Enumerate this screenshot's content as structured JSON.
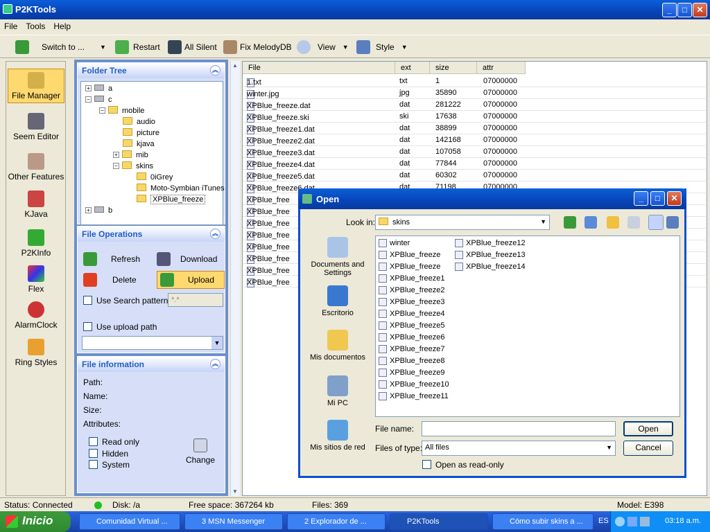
{
  "app": {
    "title": "P2KTools"
  },
  "menu": [
    "File",
    "Tools",
    "Help"
  ],
  "toolbar": {
    "switch_to": "Switch to ...",
    "restart": "Restart",
    "all_silent": "All Silent",
    "fix_melody": "Fix MelodyDB",
    "view": "View",
    "style": "Style"
  },
  "leftbar": [
    {
      "label": "File Manager",
      "icon": "file-manager-icon"
    },
    {
      "label": "Seem Editor",
      "icon": "seem-editor-icon"
    },
    {
      "label": "Other Features",
      "icon": "other-features-icon"
    },
    {
      "label": "KJava",
      "icon": "kjava-icon"
    },
    {
      "label": "P2KInfo",
      "icon": "p2kinfo-icon"
    },
    {
      "label": "Flex",
      "icon": "flex-icon"
    },
    {
      "label": "AlarmClock",
      "icon": "alarm-clock-icon"
    },
    {
      "label": "Ring Styles",
      "icon": "ring-styles-icon"
    }
  ],
  "folder_tree": {
    "title": "Folder Tree",
    "nodes": [
      "a",
      "c",
      "mobile",
      "audio",
      "picture",
      "kjava",
      "mib",
      "skins",
      "0iGrey",
      "Moto-Symbian iTunes",
      "XPBlue_freeze",
      "b"
    ]
  },
  "file_ops": {
    "title": "File Operations",
    "refresh": "Refresh",
    "download": "Download",
    "delete": "Delete",
    "upload": "Upload",
    "use_search": "Use Search pattern:",
    "search_value": "*.*",
    "use_upload_path": "Use upload path"
  },
  "file_info": {
    "title": "File information",
    "path": "Path:",
    "name": "Name:",
    "size": "Size:",
    "attributes": "Attributes:",
    "read_only": "Read only",
    "hidden": "Hidden",
    "system": "System",
    "change": "Change"
  },
  "file_list": {
    "columns": [
      "File",
      "ext",
      "size",
      "attr"
    ],
    "rows": [
      {
        "file": "1.txt",
        "ext": "txt",
        "size": "1",
        "attr": "07000000"
      },
      {
        "file": "winter.jpg",
        "ext": "jpg",
        "size": "35890",
        "attr": "07000000"
      },
      {
        "file": "XPBlue_freeze.dat",
        "ext": "dat",
        "size": "281222",
        "attr": "07000000"
      },
      {
        "file": "XPBlue_freeze.ski",
        "ext": "ski",
        "size": "17638",
        "attr": "07000000"
      },
      {
        "file": "XPBlue_freeze1.dat",
        "ext": "dat",
        "size": "38899",
        "attr": "07000000"
      },
      {
        "file": "XPBlue_freeze2.dat",
        "ext": "dat",
        "size": "142168",
        "attr": "07000000"
      },
      {
        "file": "XPBlue_freeze3.dat",
        "ext": "dat",
        "size": "107058",
        "attr": "07000000"
      },
      {
        "file": "XPBlue_freeze4.dat",
        "ext": "dat",
        "size": "77844",
        "attr": "07000000"
      },
      {
        "file": "XPBlue_freeze5.dat",
        "ext": "dat",
        "size": "60302",
        "attr": "07000000"
      },
      {
        "file": "XPBlue_freeze6.dat",
        "ext": "dat",
        "size": "71198",
        "attr": "07000000"
      },
      {
        "file": "XPBlue_free",
        "ext": "",
        "size": "",
        "attr": ""
      },
      {
        "file": "XPBlue_free",
        "ext": "",
        "size": "",
        "attr": ""
      },
      {
        "file": "XPBlue_free",
        "ext": "",
        "size": "",
        "attr": ""
      },
      {
        "file": "XPBlue_free",
        "ext": "",
        "size": "",
        "attr": ""
      },
      {
        "file": "XPBlue_free",
        "ext": "",
        "size": "",
        "attr": ""
      },
      {
        "file": "XPBlue_free",
        "ext": "",
        "size": "",
        "attr": ""
      },
      {
        "file": "XPBlue_free",
        "ext": "",
        "size": "",
        "attr": ""
      },
      {
        "file": "XPBlue_free",
        "ext": "",
        "size": "",
        "attr": ""
      }
    ]
  },
  "dialog": {
    "title": "Open",
    "look_in_label": "Look in:",
    "look_in_value": "skins",
    "places": [
      "Documents and Settings",
      "Escritorio",
      "Mis documentos",
      "Mi PC",
      "Mis sitios de red"
    ],
    "items_col1": [
      "winter",
      "XPBlue_freeze",
      "XPBlue_freeze",
      "XPBlue_freeze1",
      "XPBlue_freeze2",
      "XPBlue_freeze3",
      "XPBlue_freeze4",
      "XPBlue_freeze5",
      "XPBlue_freeze6",
      "XPBlue_freeze7",
      "XPBlue_freeze8",
      "XPBlue_freeze9",
      "XPBlue_freeze10",
      "XPBlue_freeze11"
    ],
    "items_col2": [
      "XPBlue_freeze12",
      "XPBlue_freeze13",
      "XPBlue_freeze14"
    ],
    "file_name_label": "File name:",
    "file_name_value": "",
    "file_type_label": "Files of type:",
    "file_type_value": "All files",
    "read_only": "Open as read-only",
    "open": "Open",
    "cancel": "Cancel"
  },
  "status": {
    "connection": "Status: Connected",
    "disk": "Disk: /a",
    "free": "Free space: 367264 kb",
    "files": "Files: 369",
    "model": "Model: E398"
  },
  "taskbar": {
    "start": "Inicio",
    "tasks": [
      "Comunidad Virtual ...",
      "3 MSN Messenger",
      "2 Explorador de ...",
      "P2KTools",
      "Cómo subir skins a ..."
    ],
    "lang": "ES",
    "clock": "03:18 a.m."
  }
}
